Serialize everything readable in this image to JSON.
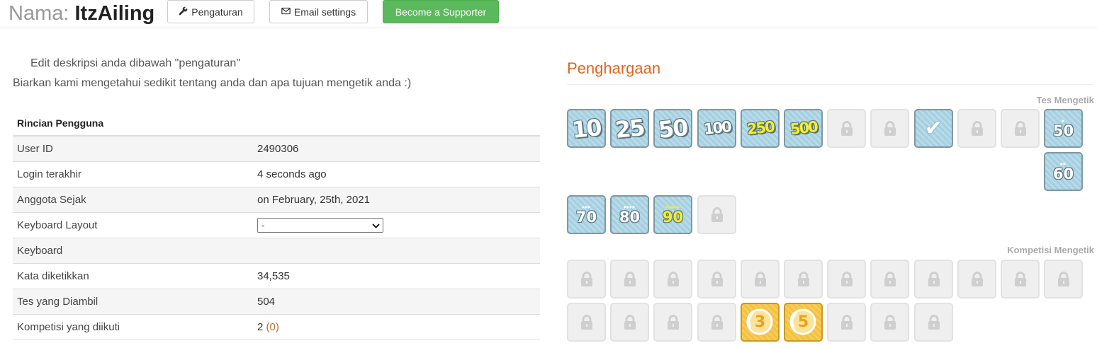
{
  "header": {
    "name_label": "Nama:",
    "username": "ItzAiling",
    "settings_button": "Pengaturan",
    "email_button": "Email settings",
    "supporter_button": "Become a Supporter"
  },
  "description": {
    "line1": "Edit deskripsi anda dibawah \"pengaturan\"",
    "line2": "Biarkan kami mengetahui sedikit tentang anda dan apa tujuan mengetik anda :)"
  },
  "details": {
    "heading": "Rincian Pengguna",
    "rows": [
      {
        "label": "User ID",
        "value": "2490306"
      },
      {
        "label": "Login terakhir",
        "value": "4 seconds ago"
      },
      {
        "label": "Anggota Sejak",
        "value": "on February, 25th, 2021"
      },
      {
        "label": "Keyboard Layout",
        "value": "-"
      },
      {
        "label": "Keyboard",
        "value": ""
      },
      {
        "label": "Kata diketikkan",
        "value": "34,535"
      },
      {
        "label": "Tes yang Diambil",
        "value": "504"
      },
      {
        "label": "Kompetisi yang diikuti",
        "value": "2",
        "extra": "(0)"
      }
    ]
  },
  "awards": {
    "title": "Penghargaan",
    "typing_tests_label": "Tes Mengetik",
    "competitions_label": "Kompetisi Mengetik",
    "typing_badges": [
      {
        "type": "count",
        "text": "10"
      },
      {
        "type": "count",
        "text": "25"
      },
      {
        "type": "count",
        "text": "50"
      },
      {
        "type": "count",
        "text": "100"
      },
      {
        "type": "count",
        "text": "250",
        "variant": "yellow"
      },
      {
        "type": "count",
        "text": "500",
        "variant": "yellow"
      },
      {
        "type": "locked"
      },
      {
        "type": "locked"
      },
      {
        "type": "check"
      },
      {
        "type": "locked"
      },
      {
        "type": "locked"
      },
      {
        "type": "speed",
        "text": "50",
        "arrows": "▸"
      },
      {
        "type": "speed",
        "text": "60",
        "arrows": "▸▸"
      },
      {
        "type": "speed",
        "text": "70",
        "arrows": "▸▸▸"
      },
      {
        "type": "speed",
        "text": "80",
        "arrows": "▸▸▸▸"
      },
      {
        "type": "speed",
        "text": "90",
        "arrows": "▸▸▸▸▸",
        "variant": "yellow"
      },
      {
        "type": "locked"
      }
    ],
    "competition_badges": [
      {
        "type": "locked"
      },
      {
        "type": "locked"
      },
      {
        "type": "locked"
      },
      {
        "type": "locked"
      },
      {
        "type": "locked"
      },
      {
        "type": "locked"
      },
      {
        "type": "locked"
      },
      {
        "type": "locked"
      },
      {
        "type": "locked"
      },
      {
        "type": "locked"
      },
      {
        "type": "locked"
      },
      {
        "type": "locked"
      },
      {
        "type": "locked"
      },
      {
        "type": "locked"
      },
      {
        "type": "locked"
      },
      {
        "type": "locked"
      },
      {
        "type": "gold",
        "text": "3"
      },
      {
        "type": "gold",
        "text": "5"
      },
      {
        "type": "locked"
      },
      {
        "type": "locked"
      },
      {
        "type": "locked"
      }
    ]
  }
}
